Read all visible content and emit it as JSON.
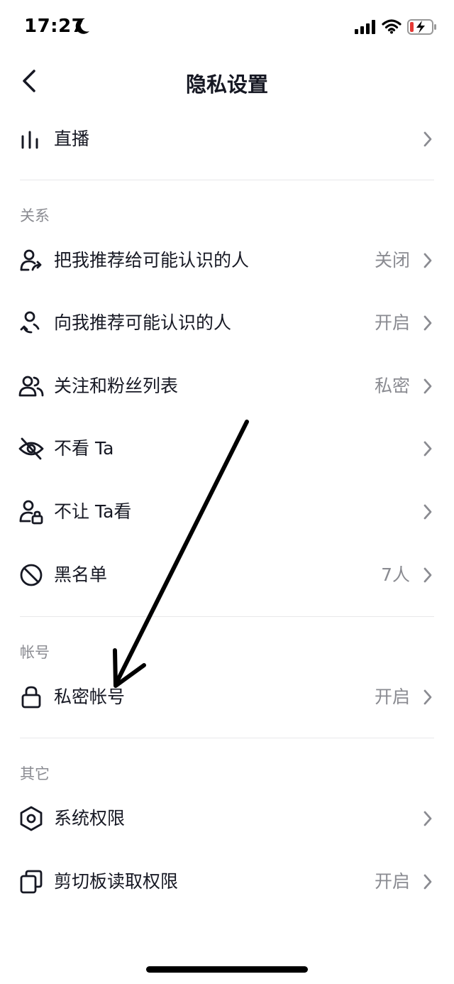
{
  "status_bar": {
    "time": "17:27"
  },
  "header": {
    "title": "隐私设置"
  },
  "top_items": [
    {
      "label": "直播",
      "value": ""
    }
  ],
  "sections": {
    "relations": {
      "title": "关系",
      "items": [
        {
          "label": "把我推荐给可能认识的人",
          "value": "关闭"
        },
        {
          "label": "向我推荐可能认识的人",
          "value": "开启"
        },
        {
          "label": "关注和粉丝列表",
          "value": "私密"
        },
        {
          "label": "不看 Ta",
          "value": ""
        },
        {
          "label": "不让 Ta看",
          "value": ""
        },
        {
          "label": "黑名单",
          "value": "7人"
        }
      ]
    },
    "account": {
      "title": "帐号",
      "items": [
        {
          "label": "私密帐号",
          "value": "开启"
        }
      ]
    },
    "other": {
      "title": "其它",
      "items": [
        {
          "label": "系统权限",
          "value": ""
        },
        {
          "label": "剪切板读取权限",
          "value": "开启"
        }
      ]
    }
  },
  "colors": {
    "text": "#161823",
    "secondary": "#8a8b91",
    "divider": "#e8e8ea"
  }
}
